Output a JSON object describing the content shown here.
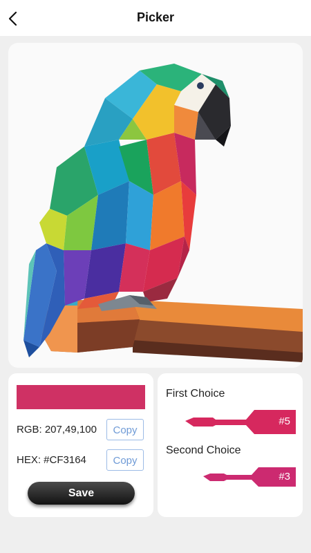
{
  "header": {
    "title": "Picker",
    "back_icon": "chevron-left-icon"
  },
  "image": {
    "description_icon": "low-poly-parrot-illustration"
  },
  "picker": {
    "swatch_color": "#CF3164",
    "rgb_label": "RGB: 207,49,100",
    "hex_label": "HEX: #CF3164",
    "copy_label": "Copy",
    "save_label": "Save"
  },
  "choices": {
    "first_label": "First Choice",
    "first_number": "#5",
    "first_color": "#D6285E",
    "second_label": "Second Choice",
    "second_number": "#3",
    "second_color": "#CC2A70"
  }
}
